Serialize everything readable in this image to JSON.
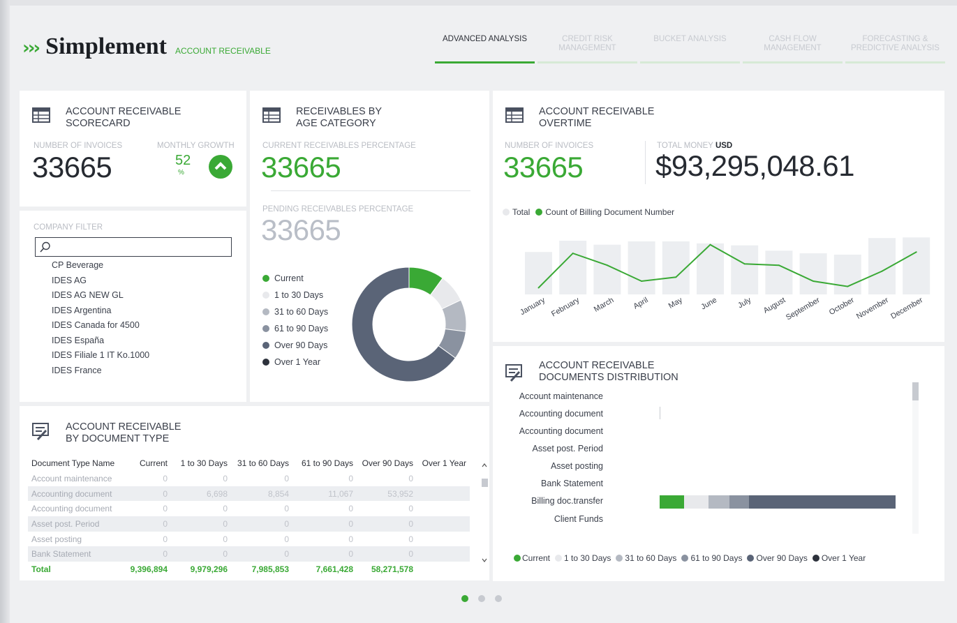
{
  "brand": {
    "name": "Simplement",
    "subtitle": "ACCOUNT RECEIVABLE",
    "arrows": "›››"
  },
  "nav": [
    {
      "label": "ADVANCED ANALYSIS",
      "active": true
    },
    {
      "label": "CREDIT RISK MANAGEMENT",
      "active": false
    },
    {
      "label": "BUCKET ANALYSIS",
      "active": false
    },
    {
      "label": "CASH FLOW MANAGEMENT",
      "active": false
    },
    {
      "label": "FORECASTING & PREDICTIVE ANALYSIS",
      "active": false
    }
  ],
  "scorecard": {
    "title_line1": "ACCOUNT RECEIVABLE",
    "title_line2": "SCORECARD",
    "invoices_label": "NUMBER OF INVOICES",
    "invoices_value": "33665",
    "growth_label": "MONTHLY GROWTH",
    "growth_value": "52",
    "growth_unit": "%"
  },
  "filter": {
    "label": "COMPANY FILTER",
    "search_value": "",
    "items": [
      "CP Beverage",
      "IDES AG",
      "IDES AG NEW GL",
      "IDES Argentina",
      "IDES Canada for 4500",
      "IDES España",
      "IDES Filiale 1 IT Ko.1000",
      "IDES France"
    ]
  },
  "age": {
    "title_line1": "RECEIVABLES BY",
    "title_line2": "AGE CATEGORY",
    "current_label": "CURRENT RECEIVABLES PERCENTAGE",
    "current_value": "33665",
    "pending_label": "PENDING RECEIVABLES PERCENTAGE",
    "pending_value": "33665",
    "legend": [
      {
        "label": "Current",
        "color": "#3aa935"
      },
      {
        "label": "1 to 30 Days",
        "color": "#e8e9ec"
      },
      {
        "label": "31 to 60 Days",
        "color": "#b4b9c2"
      },
      {
        "label": "61 to 90 Days",
        "color": "#8a92a0"
      },
      {
        "label": "Over 90 Days",
        "color": "#5a6477"
      },
      {
        "label": "Over 1 Year",
        "color": "#2d323c"
      }
    ],
    "donut_shares": [
      10,
      8,
      9,
      8,
      65,
      0
    ]
  },
  "overtime": {
    "title_line1": "ACCOUNT RECEIVABLE",
    "title_line2": "OVERTIME",
    "invoices_label": "NUMBER OF INVOICES",
    "invoices_value": "33665",
    "money_label": "TOTAL MONEY",
    "money_currency": "USD",
    "money_value": "$93,295,048.61",
    "legend_total": "Total",
    "legend_count": "Count of Billing Document Number"
  },
  "chart_data": {
    "type": "bar",
    "categories": [
      "January",
      "February",
      "March",
      "April",
      "May",
      "June",
      "July",
      "August",
      "September",
      "October",
      "November",
      "December"
    ],
    "series": [
      {
        "name": "Total",
        "values": [
          64,
          81,
          75,
          80,
          80,
          77,
          74,
          66,
          62,
          60,
          85,
          86
        ]
      },
      {
        "name": "Count of Billing Document Number",
        "values": [
          10,
          62,
          44,
          20,
          26,
          75,
          46,
          44,
          20,
          12,
          35,
          64
        ]
      }
    ],
    "ylim": [
      0,
      100
    ]
  },
  "doctype": {
    "title_line1": "ACCOUNT RECEIVABLE",
    "title_line2": "BY DOCUMENT TYPE",
    "columns": [
      "Document Type Name",
      "Current",
      "1 to 30 Days",
      "31 to 60 Days",
      "61 to 90 Days",
      "Over 90 Days",
      "Over 1 Year"
    ],
    "rows": [
      [
        "Account maintenance",
        "0",
        "0",
        "0",
        "0",
        "0",
        ""
      ],
      [
        "Accounting document",
        "0",
        "6,698",
        "8,854",
        "11,067",
        "53,952",
        ""
      ],
      [
        "Accounting document",
        "0",
        "0",
        "0",
        "0",
        "0",
        ""
      ],
      [
        "Asset post. Period",
        "0",
        "0",
        "0",
        "0",
        "0",
        ""
      ],
      [
        "Asset posting",
        "0",
        "0",
        "0",
        "0",
        "0",
        ""
      ],
      [
        "Bank Statement",
        "0",
        "0",
        "0",
        "0",
        "0",
        ""
      ]
    ],
    "total": [
      "Total",
      "9,396,894",
      "9,979,296",
      "7,985,853",
      "7,661,428",
      "58,271,578",
      ""
    ]
  },
  "distribution": {
    "title_line1": "ACCOUNT RECEIVABLE",
    "title_line2": "DOCUMENTS DISTRIBUTION",
    "labels": [
      "Account maintenance",
      "Accounting document",
      "Accounting document",
      "Asset post. Period",
      "Asset posting",
      "Bank Statement",
      "Billing doc.transfer",
      "Client Funds"
    ],
    "legend": [
      "Current",
      "1 to 30 Days",
      "31 to 60 Days",
      "61 to 90 Days",
      "Over 90 Days",
      "Over 1 Year"
    ]
  },
  "pager": {
    "pages": 3,
    "current": 1
  }
}
